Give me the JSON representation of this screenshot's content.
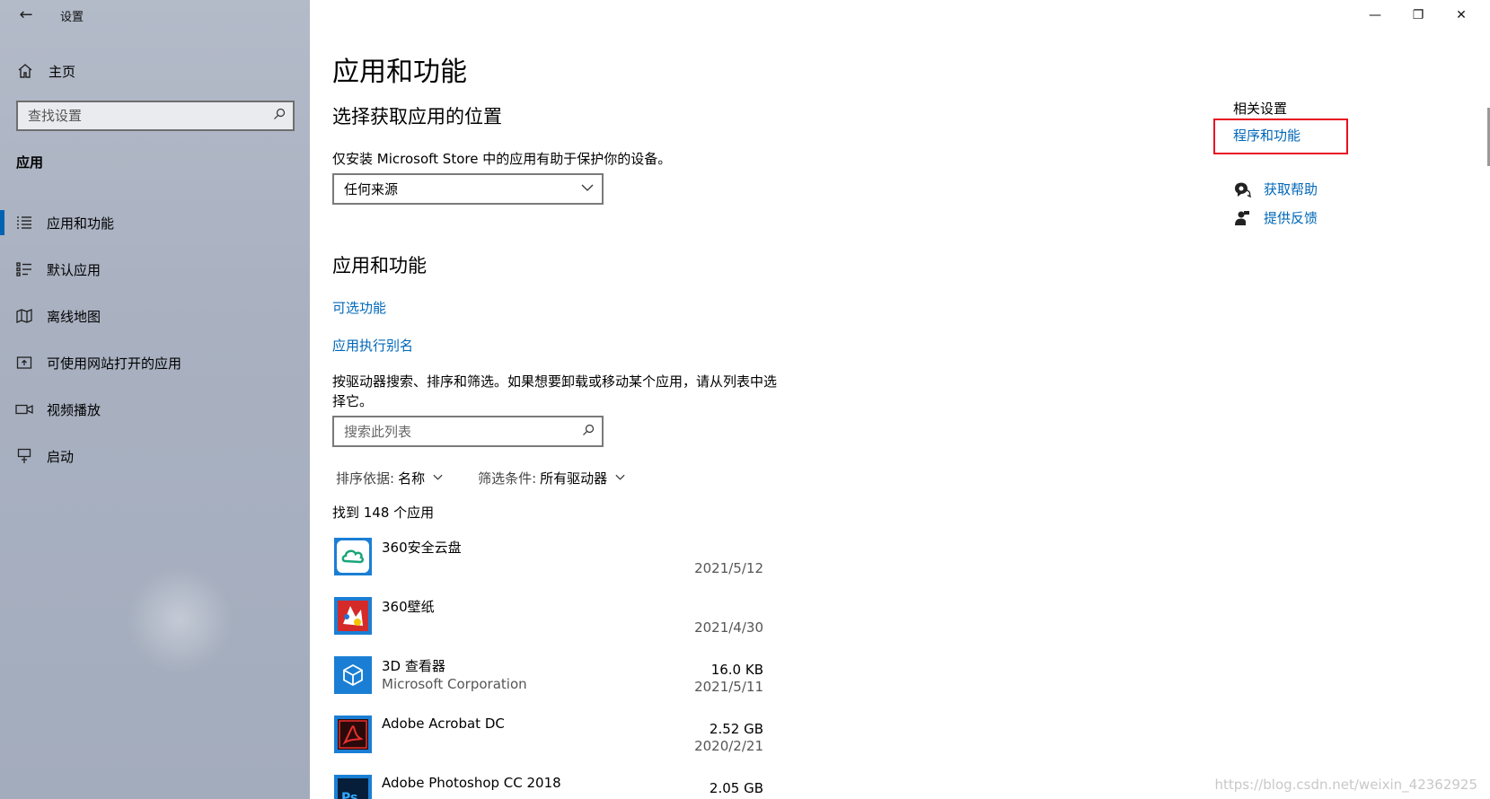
{
  "window": {
    "title": "设置",
    "minimize_glyph": "—",
    "maximize_glyph": "❐",
    "close_glyph": "✕"
  },
  "sidebar": {
    "back_glyph": "←",
    "home_label": "主页",
    "search_placeholder": "查找设置",
    "section": "应用",
    "items": [
      {
        "label": "应用和功能",
        "icon": "apps-features-icon",
        "active": true
      },
      {
        "label": "默认应用",
        "icon": "default-apps-icon",
        "active": false
      },
      {
        "label": "离线地图",
        "icon": "offline-maps-icon",
        "active": false
      },
      {
        "label": "可使用网站打开的应用",
        "icon": "apps-for-websites-icon",
        "active": false
      },
      {
        "label": "视频播放",
        "icon": "video-playback-icon",
        "active": false
      },
      {
        "label": "启动",
        "icon": "startup-icon",
        "active": false
      }
    ]
  },
  "main": {
    "title": "应用和功能",
    "install_section": {
      "heading": "选择获取应用的位置",
      "description": "仅安装 Microsoft Store 中的应用有助于保护你的设备。",
      "dropdown_value": "任何来源"
    },
    "apps_section": {
      "heading": "应用和功能",
      "link_optional": "可选功能",
      "link_alias": "应用执行别名",
      "description": "按驱动器搜索、排序和筛选。如果想要卸载或移动某个应用，请从列表中选择它。",
      "search_placeholder": "搜索此列表",
      "sort_key": "排序依据:",
      "sort_value": "名称",
      "filter_key": "筛选条件:",
      "filter_value": "所有驱动器",
      "count_text": "找到 148 个应用"
    },
    "apps": [
      {
        "name": "360安全云盘",
        "publisher": "",
        "size": "",
        "date": "2021/5/12",
        "icon": "cloud-icon"
      },
      {
        "name": "360壁纸",
        "publisher": "",
        "size": "",
        "date": "2021/4/30",
        "icon": "wallpaper-icon"
      },
      {
        "name": "3D 查看器",
        "publisher": "Microsoft Corporation",
        "size": "16.0 KB",
        "date": "2021/5/11",
        "icon": "cube-icon"
      },
      {
        "name": "Adobe Acrobat DC",
        "publisher": "",
        "size": "2.52 GB",
        "date": "2020/2/21",
        "icon": "acrobat-icon"
      },
      {
        "name": "Adobe Photoshop CC 2018",
        "publisher": "",
        "size": "2.05 GB",
        "date": "",
        "icon": "photoshop-icon"
      }
    ]
  },
  "related": {
    "heading": "相关设置",
    "programs_link": "程序和功能",
    "help_link": "获取帮助",
    "feedback_link": "提供反馈"
  },
  "watermark": "https://blog.csdn.net/weixin_42362925",
  "colors": {
    "accent": "#0067b8",
    "highlight_box": "#e81123",
    "sidebar_bg": "#a9b1c1"
  }
}
